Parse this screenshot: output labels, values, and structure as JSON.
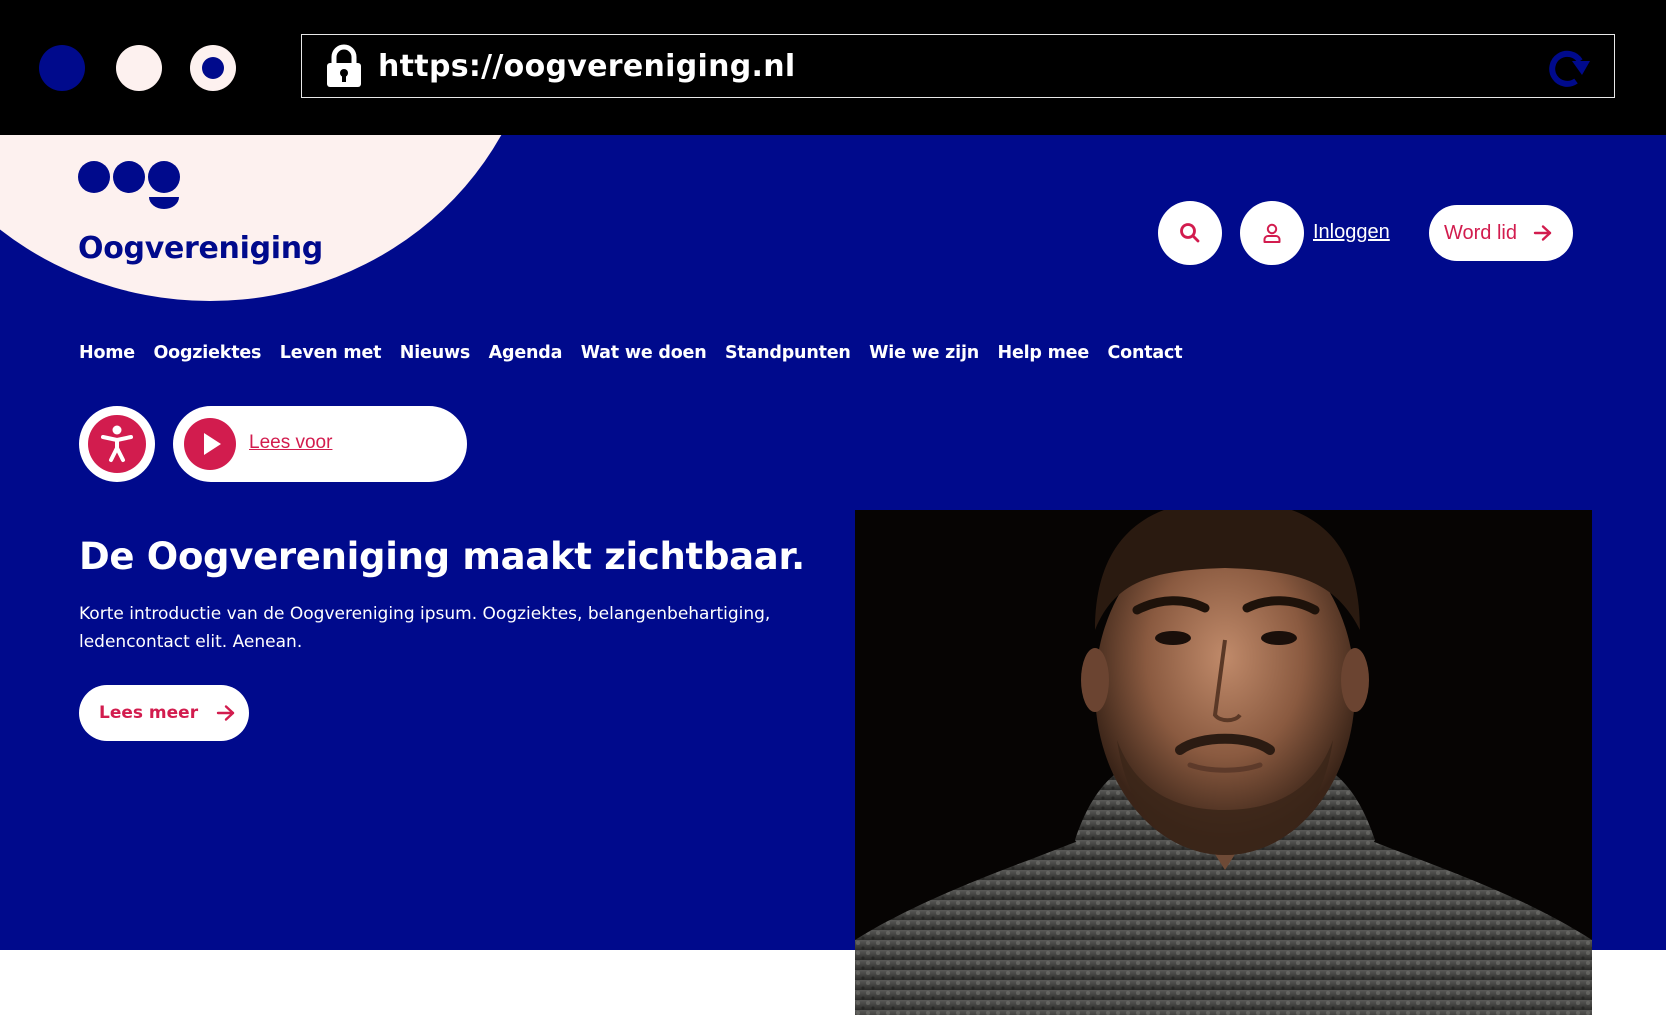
{
  "browser": {
    "window_dots": [
      "close",
      "minimize",
      "maximize"
    ],
    "url": "https://oogvereniging.nl",
    "icons": {
      "lock": "lock-icon",
      "reload": "reload-icon"
    }
  },
  "colors": {
    "brand_blue": "#000a8c",
    "accent_red": "#d21c4e",
    "cream": "#fdf1ef",
    "white": "#ffffff"
  },
  "header": {
    "logo_text": "Oogvereniging",
    "search_icon": "search-icon",
    "user_icon": "user-icon",
    "login_label": "Inloggen",
    "join_label": "Word lid"
  },
  "nav": {
    "items": [
      "Home",
      "Oogziektes",
      "Leven met",
      "Nieuws",
      "Agenda",
      "Wat we doen",
      "Standpunten",
      "Wie we zijn",
      "Help mee",
      "Contact"
    ]
  },
  "accessibility": {
    "icon": "accessibility-icon",
    "read_aloud_icon": "play-icon",
    "read_aloud_label": "Lees voor"
  },
  "hero": {
    "title": "De Oogvereniging maakt zichtbaar.",
    "intro": "Korte introductie van de Oogvereniging ipsum. Oogziektes, belangenbehartiging, ledencontact elit. Aenean.",
    "cta_label": "Lees meer",
    "image": "portrait-photo"
  }
}
